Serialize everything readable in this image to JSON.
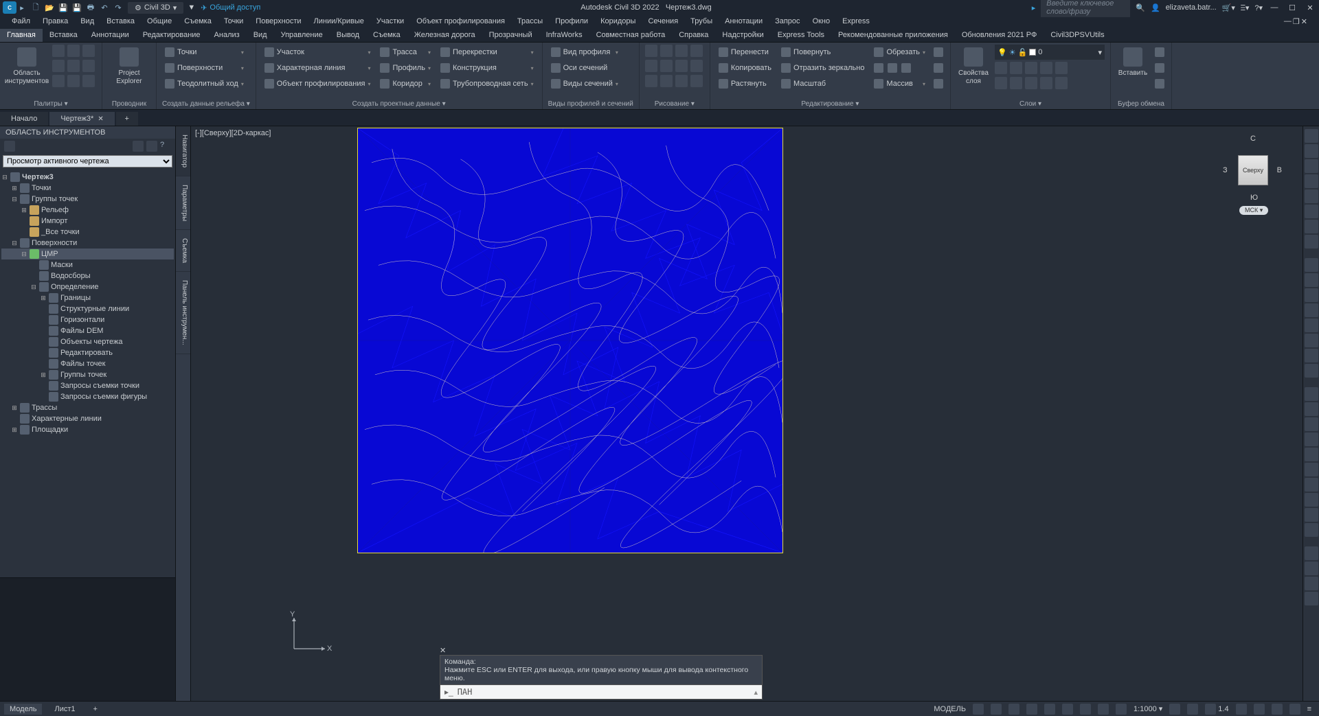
{
  "title": {
    "app": "Autodesk Civil 3D 2022",
    "doc": "Чертеж3.dwg"
  },
  "workspace": "Civil 3D",
  "share": "Общий доступ",
  "search_ph": "Введите ключевое слово/фразу",
  "user": "elizaveta.batr...",
  "menu": [
    "Файл",
    "Правка",
    "Вид",
    "Вставка",
    "Общие",
    "Съемка",
    "Точки",
    "Поверхности",
    "Линии/Кривые",
    "Участки",
    "Объект профилирования",
    "Трассы",
    "Профили",
    "Коридоры",
    "Сечения",
    "Трубы",
    "Аннотации",
    "Запрос",
    "Окно",
    "Express"
  ],
  "ribtabs": [
    "Главная",
    "Вставка",
    "Аннотации",
    "Редактирование",
    "Анализ",
    "Вид",
    "Управление",
    "Вывод",
    "Съемка",
    "Железная дорога",
    "Прозрачный",
    "InfraWorks",
    "Совместная работа",
    "Справка",
    "Надстройки",
    "Express Tools",
    "Рекомендованные приложения",
    "Обновления 2021 РФ",
    "Civil3DPSVUtils"
  ],
  "rp": {
    "palettes": {
      "title": "Палитры ▾",
      "big": "Область инструментов"
    },
    "explorer": {
      "title": "Проводник",
      "big": "Project\nExplorer"
    },
    "ground": {
      "title": "Создать данные рельефа ▾",
      "r": [
        "Точки",
        "Поверхности",
        "Теодолитный ход"
      ]
    },
    "design": {
      "title": "Создать проектные данные ▾",
      "c1": [
        "Участок",
        "Характерная линия",
        "Объект профилирования"
      ],
      "c2": [
        "Трасса",
        "Профиль",
        "Коридор"
      ],
      "c3": [
        "Перекрестки",
        "Конструкция",
        "Трубопроводная сеть"
      ]
    },
    "profile": {
      "title": "Виды профилей и сечений",
      "r": [
        "Вид профиля",
        "Оси сечений",
        "Виды сечений"
      ]
    },
    "draw": {
      "title": "Рисование ▾"
    },
    "modify": {
      "title": "Редактирование ▾",
      "c1": [
        "Перенести",
        "Копировать",
        "Растянуть"
      ],
      "c2": [
        "Повернуть",
        "Отразить зеркально",
        "Масштаб"
      ],
      "c3": [
        "Обрезать",
        "",
        "Массив"
      ]
    },
    "layers": {
      "title": "Слои ▾",
      "big": "Свойства\nслоя",
      "cur": "0"
    },
    "clip": {
      "title": "Буфер обмена",
      "big": "Вставить"
    }
  },
  "filetabs": {
    "start": "Начало",
    "doc": "Чертеж3*"
  },
  "toolspace": {
    "title": "ОБЛАСТЬ ИНСТРУМЕНТОВ",
    "view": "Просмотр активного чертежа",
    "vtabs": [
      "Навигатор",
      "Параметры",
      "Съемка",
      "Панель инструмен..."
    ],
    "tree": {
      "root": "Чертеж3",
      "n1": "Точки",
      "n2": "Группы точек",
      "n2a": "Рельеф",
      "n2b": "Импорт",
      "n2c": "_Все точки",
      "n3": "Поверхности",
      "n3a": "ЦМР",
      "n3a1": "Маски",
      "n3a2": "Водосборы",
      "n3a3": "Определение",
      "n3a3a": "Границы",
      "n3a3b": "Структурные линии",
      "n3a3c": "Горизонтали",
      "n3a3d": "Файлы DEM",
      "n3a3e": "Объекты чертежа",
      "n3a3f": "Редактировать",
      "n3a3g": "Файлы точек",
      "n3a3h": "Группы точек",
      "n3a3i": "Запросы съемки точки",
      "n3a3j": "Запросы съемки фигуры",
      "n4": "Трассы",
      "n5": "Характерные линии",
      "n6": "Площадки"
    }
  },
  "viewport": "[-][Сверху][2D-каркас]",
  "viewcube": {
    "top": "Сверху",
    "n": "С",
    "s": "Ю",
    "e": "В",
    "w": "З",
    "wcs": "МСК ▾"
  },
  "ucs": {
    "x": "X",
    "y": "Y"
  },
  "cmd": {
    "h1": "Команда:",
    "h2": "Нажмите ESC или ENTER для выхода, или правую кнопку мыши для вывода контекстного меню.",
    "cur": "ПАН"
  },
  "layout": {
    "model": "Модель",
    "l1": "Лист1"
  },
  "status": {
    "space": "МОДЕЛЬ",
    "scale": "1:1000 ▾",
    "anno": "1.4"
  }
}
